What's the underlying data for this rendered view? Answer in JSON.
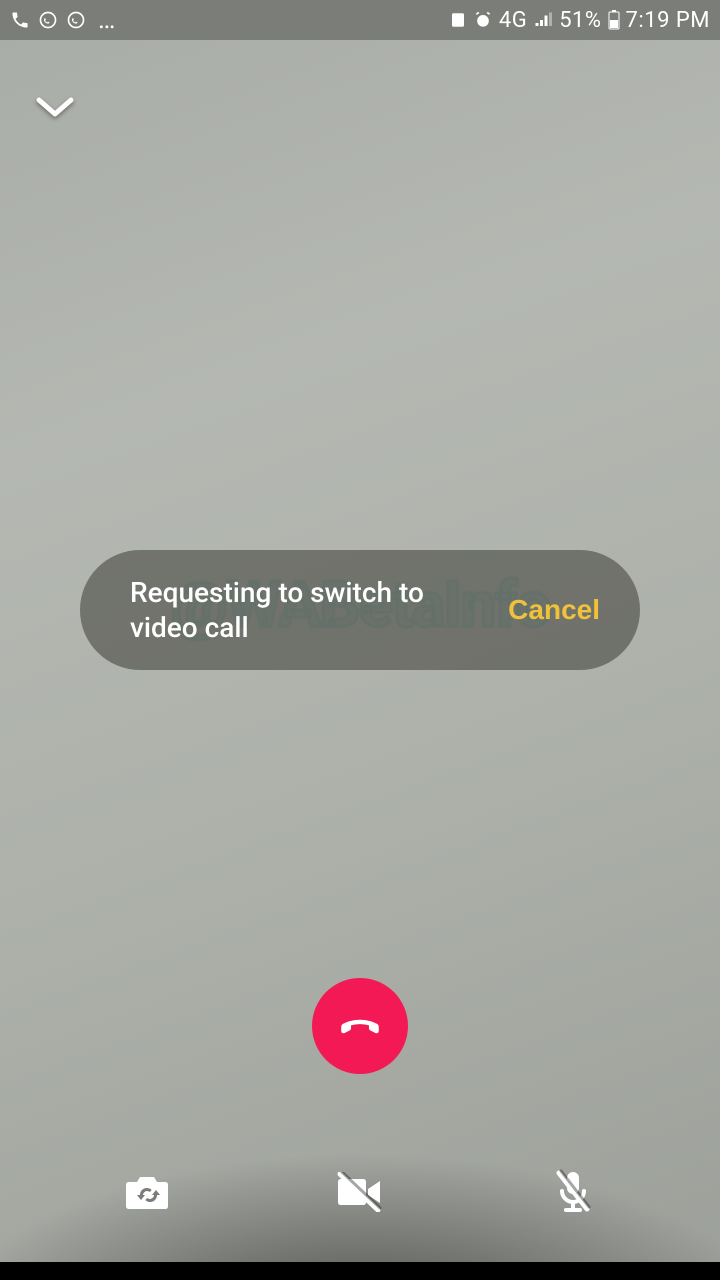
{
  "status": {
    "network": "4G",
    "battery_percent": "51%",
    "time": "7:19 PM"
  },
  "toast": {
    "message": "Requesting to switch to video call",
    "cancel_label": "Cancel"
  },
  "watermark": "@WABetaInfo",
  "colors": {
    "end_call": "#f31954",
    "cancel": "#f0c23a"
  }
}
